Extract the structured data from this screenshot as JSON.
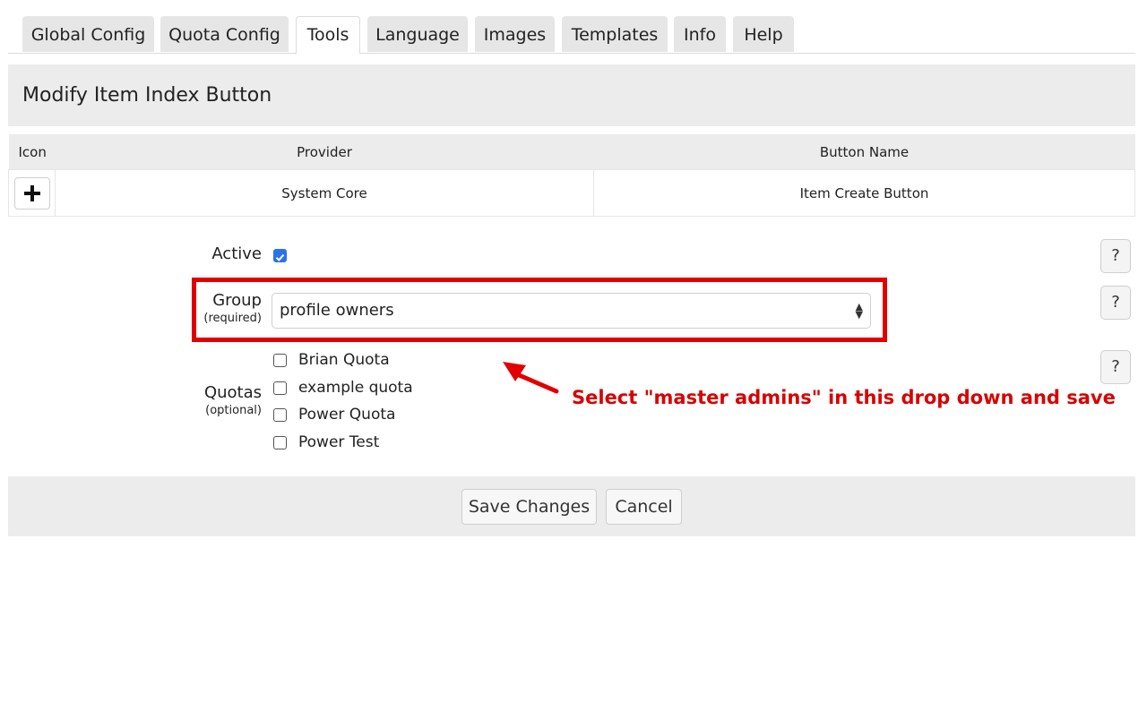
{
  "tabs": [
    {
      "label": "Global Config"
    },
    {
      "label": "Quota Config"
    },
    {
      "label": "Tools",
      "active": true
    },
    {
      "label": "Language"
    },
    {
      "label": "Images"
    },
    {
      "label": "Templates"
    },
    {
      "label": "Info"
    },
    {
      "label": "Help"
    }
  ],
  "panel": {
    "title": "Modify Item Index Button"
  },
  "table": {
    "headers": {
      "icon": "Icon",
      "provider": "Provider",
      "button_name": "Button Name"
    },
    "row": {
      "icon": "plus-icon",
      "provider": "System Core",
      "button_name": "Item Create Button"
    }
  },
  "form": {
    "active": {
      "label": "Active",
      "checked": true
    },
    "group": {
      "label": "Group",
      "sub": "(required)",
      "value": "profile owners"
    },
    "quotas": {
      "label": "Quotas",
      "sub": "(optional)",
      "options": [
        {
          "label": "Brian Quota",
          "checked": false
        },
        {
          "label": "example quota",
          "checked": false
        },
        {
          "label": "Power Quota",
          "checked": false
        },
        {
          "label": "Power Test",
          "checked": false
        }
      ]
    },
    "help_label": "?"
  },
  "annotation": {
    "text": "Select \"master admins\" in this drop down and save",
    "color": "#d90000"
  },
  "footer": {
    "save_label": "Save Changes",
    "cancel_label": "Cancel"
  },
  "colors": {
    "accent": "#2a73e8",
    "highlight": "#e00000",
    "panel": "#ececec"
  }
}
